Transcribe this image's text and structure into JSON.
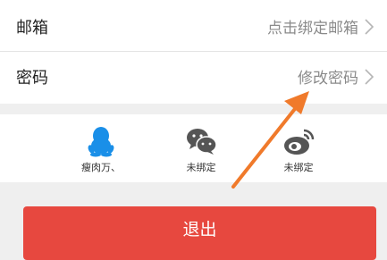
{
  "account": {
    "email_label": "邮箱",
    "email_value": "点击绑定邮箱",
    "password_label": "密码",
    "password_value": "修改密码"
  },
  "social": [
    {
      "icon": "qq-icon",
      "label": "瘦肉万、"
    },
    {
      "icon": "wechat-icon",
      "label": "未绑定"
    },
    {
      "icon": "weibo-icon",
      "label": "未绑定"
    }
  ],
  "logout_label": "退出",
  "colors": {
    "logout_button": "#e7483f",
    "qq_icon": "#1a8fe8",
    "inactive_icon": "#555555",
    "annotation_arrow": "#f07a2b"
  }
}
